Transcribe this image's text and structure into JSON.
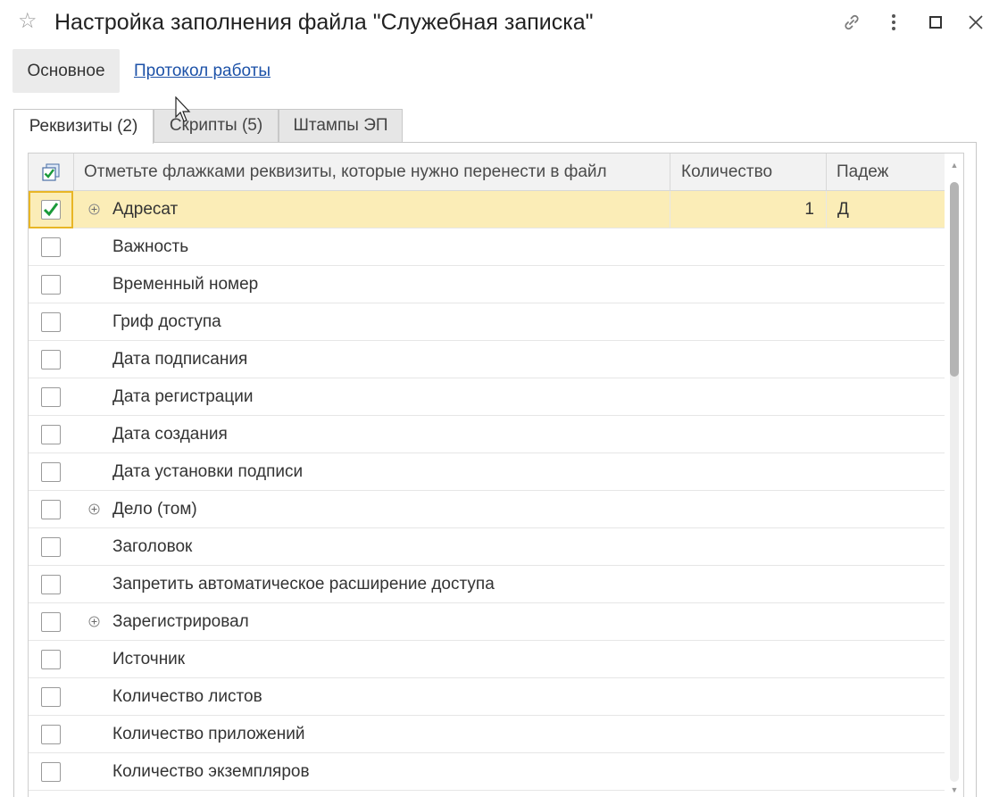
{
  "window": {
    "title": "Настройка заполнения файла \"Служебная записка\"",
    "favorite_icon": "star-icon",
    "controls": [
      "link-icon",
      "more-icon",
      "maximize-icon",
      "close-icon"
    ]
  },
  "commandbar": {
    "main_label": "Основное",
    "protocol_link": "Протокол работы"
  },
  "tabs": [
    {
      "label": "Реквизиты (2)",
      "active": true
    },
    {
      "label": "Скрипты (5)",
      "active": false
    },
    {
      "label": "Штампы ЭП",
      "active": false
    }
  ],
  "table": {
    "columns": {
      "check_icon": "check-all-icon",
      "name": "Отметьте флажками реквизиты, которые нужно перенести в файл",
      "count": "Количество",
      "case": "Падеж"
    },
    "rows": [
      {
        "label": "Адресат",
        "checked": true,
        "expandable": true,
        "count": "1",
        "case": "Д"
      },
      {
        "label": "Важность",
        "checked": false,
        "expandable": false,
        "count": "",
        "case": ""
      },
      {
        "label": "Временный номер",
        "checked": false,
        "expandable": false,
        "count": "",
        "case": ""
      },
      {
        "label": "Гриф доступа",
        "checked": false,
        "expandable": false,
        "count": "",
        "case": ""
      },
      {
        "label": "Дата подписания",
        "checked": false,
        "expandable": false,
        "count": "",
        "case": ""
      },
      {
        "label": "Дата регистрации",
        "checked": false,
        "expandable": false,
        "count": "",
        "case": ""
      },
      {
        "label": "Дата создания",
        "checked": false,
        "expandable": false,
        "count": "",
        "case": ""
      },
      {
        "label": "Дата установки подписи",
        "checked": false,
        "expandable": false,
        "count": "",
        "case": ""
      },
      {
        "label": "Дело (том)",
        "checked": false,
        "expandable": true,
        "count": "",
        "case": ""
      },
      {
        "label": "Заголовок",
        "checked": false,
        "expandable": false,
        "count": "",
        "case": ""
      },
      {
        "label": "Запретить автоматическое расширение доступа",
        "checked": false,
        "expandable": false,
        "count": "",
        "case": ""
      },
      {
        "label": "Зарегистрировал",
        "checked": false,
        "expandable": true,
        "count": "",
        "case": ""
      },
      {
        "label": "Источник",
        "checked": false,
        "expandable": false,
        "count": "",
        "case": ""
      },
      {
        "label": "Количество листов",
        "checked": false,
        "expandable": false,
        "count": "",
        "case": ""
      },
      {
        "label": "Количество приложений",
        "checked": false,
        "expandable": false,
        "count": "",
        "case": ""
      },
      {
        "label": "Количество экземпляров",
        "checked": false,
        "expandable": false,
        "count": "",
        "case": ""
      }
    ]
  },
  "colors": {
    "selected_row": "#fbedb7",
    "focus_border": "#e8b626",
    "link": "#1d52a8",
    "check_mark": "#1a9a3a"
  }
}
